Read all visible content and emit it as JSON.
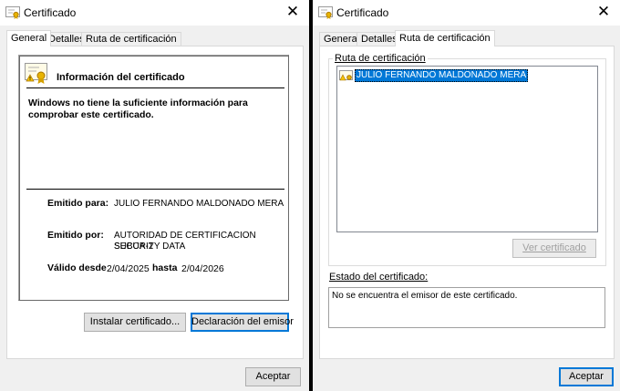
{
  "left_window": {
    "title": "Certificado",
    "tabs": [
      {
        "label": "General",
        "active": true
      },
      {
        "label": "Detalles",
        "active": false
      },
      {
        "label": "Ruta de certificación",
        "active": false
      }
    ],
    "info_title": "Información del certificado",
    "warning": "Windows no tiene la suficiente información para comprobar este certificado.",
    "issued_to_label": "Emitido para:",
    "issued_to_value": "JULIO FERNANDO MALDONADO MERA",
    "issued_by_label": "Emitido por:",
    "issued_by_line1": "AUTORIDAD DE CERTIFICACION SUBCA-2",
    "issued_by_line2": "SECURITY DATA",
    "valid_from_label": "Válido desde",
    "valid_from_value": "2/04/2025",
    "valid_to_label": "hasta",
    "valid_to_value": "2/04/2026",
    "install_button": "Instalar certificado...",
    "issuer_statement_button": "Declaración del emisor",
    "ok_button": "Aceptar"
  },
  "right_window": {
    "title": "Certificado",
    "tabs": [
      {
        "label": "General",
        "active": false
      },
      {
        "label": "Detalles",
        "active": false
      },
      {
        "label": "Ruta de certificación",
        "active": true
      }
    ],
    "path_group_label": "Ruta de certificación",
    "path_items": [
      "JULIO FERNANDO MALDONADO MERA"
    ],
    "view_cert_button": "Ver certificado",
    "status_label": "Estado del certificado:",
    "status_text": "No se encuentra el emisor de este certificado.",
    "ok_button": "Aceptar"
  },
  "colors": {
    "selection": "#0078d7",
    "focus_border": "#0078d7",
    "window_bg": "#f0f0f0",
    "separator_bg": "#000000"
  },
  "icons": [
    "certificate-icon",
    "close-icon",
    "certificate-warning-icon"
  ]
}
